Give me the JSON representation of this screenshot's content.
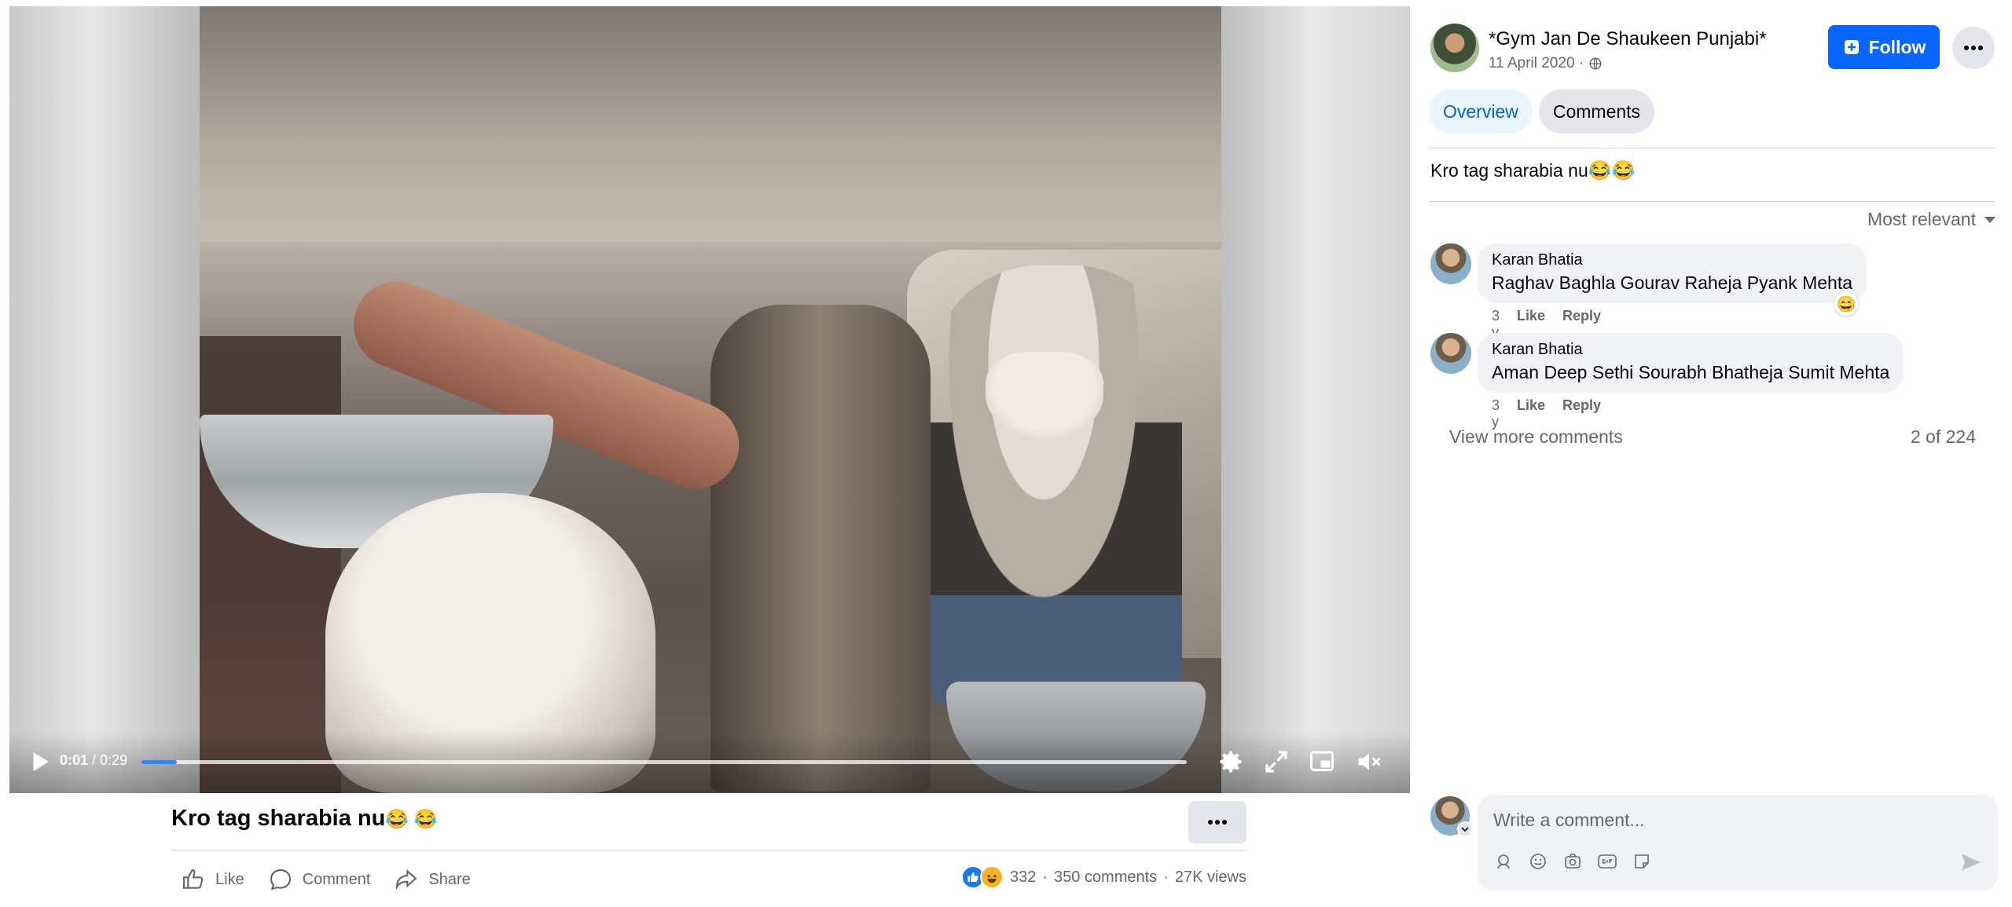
{
  "video": {
    "time_current": "0:01",
    "time_separator": " / ",
    "time_total": "0:29",
    "progress_fraction": 0.034
  },
  "post": {
    "title": "Kro tag sharabia nu",
    "title_emojis": "😂 😂",
    "actions": {
      "like": "Like",
      "comment": "Comment",
      "share": "Share"
    },
    "reaction_count": "332",
    "comments_count": "350 comments",
    "views": "27K views",
    "sep": "·"
  },
  "page": {
    "name": "*Gym Jan De Shaukeen Punjabi*",
    "date": "11 April 2020 ·",
    "follow_label": "Follow"
  },
  "tabs": {
    "overview": "Overview",
    "comments": "Comments"
  },
  "caption": {
    "text": "Kro tag sharabia nu",
    "emojis": "😂😂"
  },
  "sort": {
    "label": "Most relevant"
  },
  "comments": [
    {
      "author": "Karan Bhatia",
      "text": "Raghav Baghla Gourav Raheja Pyank Mehta",
      "age": "3 y",
      "like": "Like",
      "reply": "Reply",
      "reaction": "😄"
    },
    {
      "author": "Karan Bhatia",
      "text": "Aman Deep Sethi Sourabh Bhatheja Sumit Mehta",
      "age": "3 y",
      "like": "Like",
      "reply": "Reply"
    }
  ],
  "view_more": {
    "label": "View more comments",
    "count": "2 of 224"
  },
  "composer": {
    "placeholder": "Write a comment..."
  },
  "colors": {
    "accent": "#0866ff",
    "progress": "#2d88ff",
    "tab_active_bg": "#ebf5ff",
    "like_blue": "#1877f2"
  },
  "icons": [
    "play-icon",
    "settings-icon",
    "fullscreen-icon",
    "pip-icon",
    "mute-icon",
    "more-icon",
    "like-icon",
    "comment-icon",
    "share-icon",
    "globe-icon",
    "follow-plus-icon",
    "sort-caret-icon",
    "avatar-sticker-icon",
    "emoji-icon",
    "camera-icon",
    "gif-icon",
    "sticker-icon",
    "send-icon"
  ]
}
